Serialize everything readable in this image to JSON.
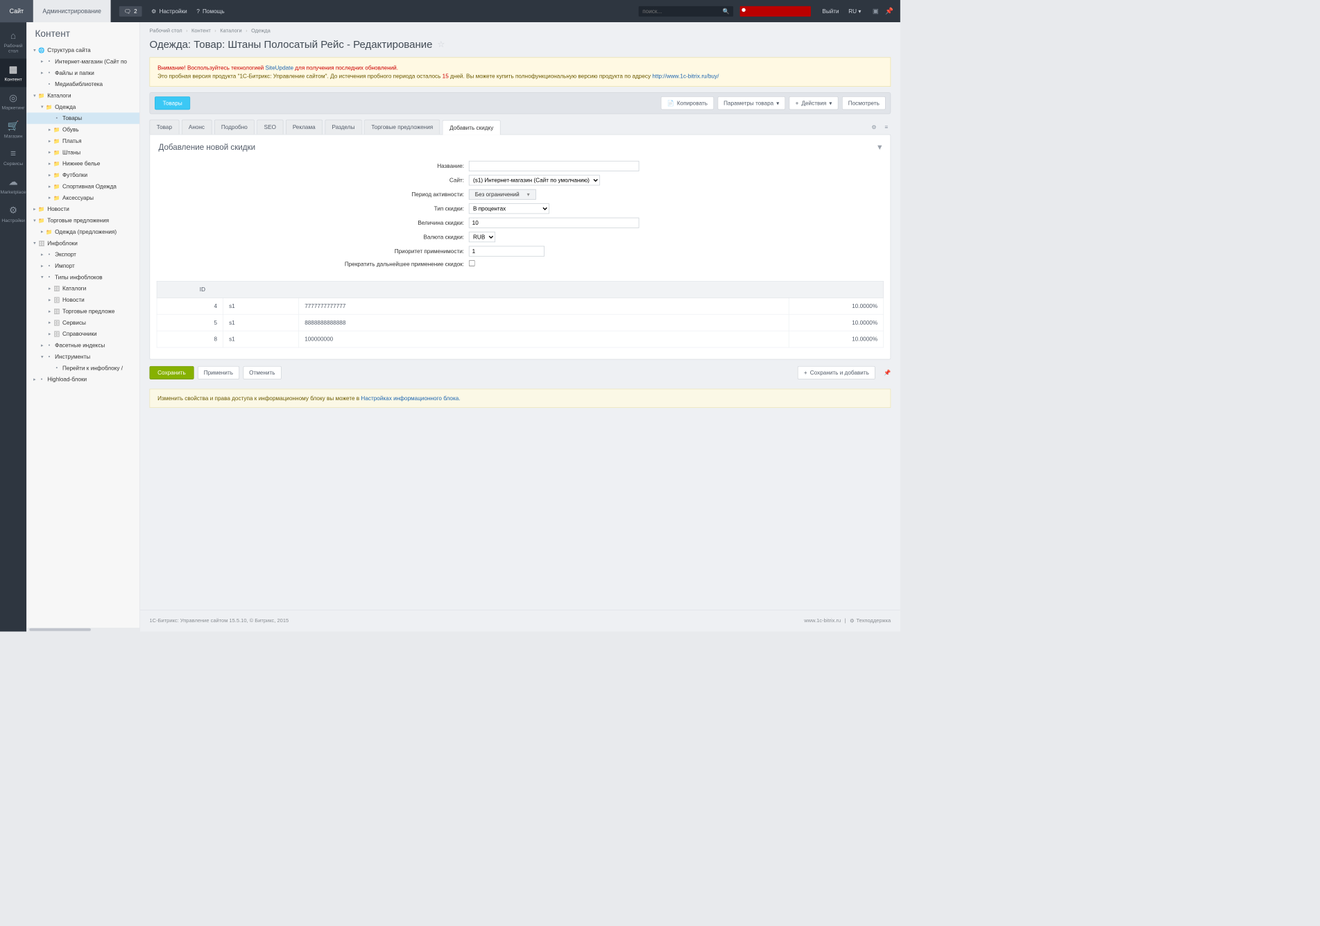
{
  "header": {
    "tab_site": "Сайт",
    "tab_admin": "Администрирование",
    "notif_count": "2",
    "settings": "Настройки",
    "help": "Помощь",
    "search_placeholder": "поиск...",
    "logout": "Выйти",
    "lang": "RU"
  },
  "rail": {
    "desk": "Рабочий стол",
    "content": "Контент",
    "marketing": "Маркетинг",
    "store": "Магазин",
    "services": "Сервисы",
    "market": "Marketplace",
    "sett": "Настройки"
  },
  "sidebar": {
    "title": "Контент",
    "struct": "Структура сайта",
    "inet": "Интернет-магазин (Сайт по",
    "files": "Файлы и папки",
    "media": "Медиабиблиотека",
    "catalogs": "Каталоги",
    "clothes": "Одежда",
    "tovary": "Товары",
    "obuv": "Обувь",
    "platya": "Платья",
    "shtany": "Штаны",
    "nizh": "Нижнее белье",
    "futb": "Футболки",
    "sport": "Спортивная Одежда",
    "aks": "Аксессуары",
    "news": "Новости",
    "torg": "Торговые предложения",
    "torg_cl": "Одежда (предложения)",
    "infob": "Инфоблоки",
    "exp": "Экспорт",
    "imp": "Импорт",
    "types": "Типы инфоблоков",
    "t_cat": "Каталоги",
    "t_news": "Новости",
    "t_torg": "Торговые предложе",
    "t_serv": "Сервисы",
    "t_spr": "Справочники",
    "facet": "Фасетные индексы",
    "tools": "Инструменты",
    "goto": "Перейти к инфоблоку /",
    "hl": "Highload-блоки"
  },
  "breadcrumb": {
    "desk": "Рабочий стол",
    "content": "Контент",
    "catalogs": "Каталоги",
    "clothes": "Одежда"
  },
  "page_title": "Одежда: Товар: Штаны Полосатый Рейс - Редактирование",
  "alert": {
    "l1a": "Внимание! Воспользуйтесь технологией ",
    "l1_link": "SiteUpdate",
    "l1b": " для получения последних обновлений.",
    "l2a": "Это пробная версия продукта \"1С-Битрикс: Управление сайтом\". До истечения пробного периода осталось ",
    "l2_days": "15",
    "l2b": " дней. Вы можете купить полнофункциональную версию продукта по адресу ",
    "l2_link": "http://www.1c-bitrix.ru/buy/"
  },
  "toolbar": {
    "tovary": "Товары",
    "copy": "Копировать",
    "params": "Параметры товара",
    "actions": "Действия",
    "view": "Посмотреть"
  },
  "tabs": {
    "tovar": "Товар",
    "anons": "Анонс",
    "detail": "Подробно",
    "seo": "SEO",
    "rekl": "Реклама",
    "razd": "Разделы",
    "torg": "Торговые предложения",
    "add": "Добавить скидку"
  },
  "panel_title": "Добавление новой скидки",
  "form": {
    "name": "Название:",
    "site": "Сайт:",
    "site_val": "(s1) Интернет-магазин (Сайт по умолчанию)",
    "period": "Период активности:",
    "period_val": "Без ограничений",
    "type": "Тип скидки:",
    "type_val": "В процентах",
    "value": "Величина скидки:",
    "value_val": "10",
    "curr": "Валюта скидки:",
    "curr_val": "RUB",
    "prio": "Приоритет применимости:",
    "prio_val": "1",
    "stop": "Прекратить дальнейшее применение скидок:"
  },
  "table": {
    "h_id": "ID",
    "rows": [
      {
        "id": "4",
        "site": "s1",
        "name": "7777777777777",
        "pct": "10.0000%"
      },
      {
        "id": "5",
        "site": "s1",
        "name": "8888888888888",
        "pct": "10.0000%"
      },
      {
        "id": "8",
        "site": "s1",
        "name": "100000000",
        "pct": "10.0000%"
      }
    ]
  },
  "save": {
    "save": "Сохранить",
    "apply": "Применить",
    "cancel": "Отменить",
    "save_add": "Сохранить и добавить"
  },
  "info": {
    "a": "Изменить свойства и права доступа к информационному блоку вы можете в ",
    "link": "Настройках информационного блока."
  },
  "footer": {
    "left": "1С-Битрикс: Управление сайтом 15.5.10, © Битрикс, 2015",
    "site": "www.1c-bitrix.ru",
    "sep": "|",
    "sup": "Техподдержка"
  }
}
